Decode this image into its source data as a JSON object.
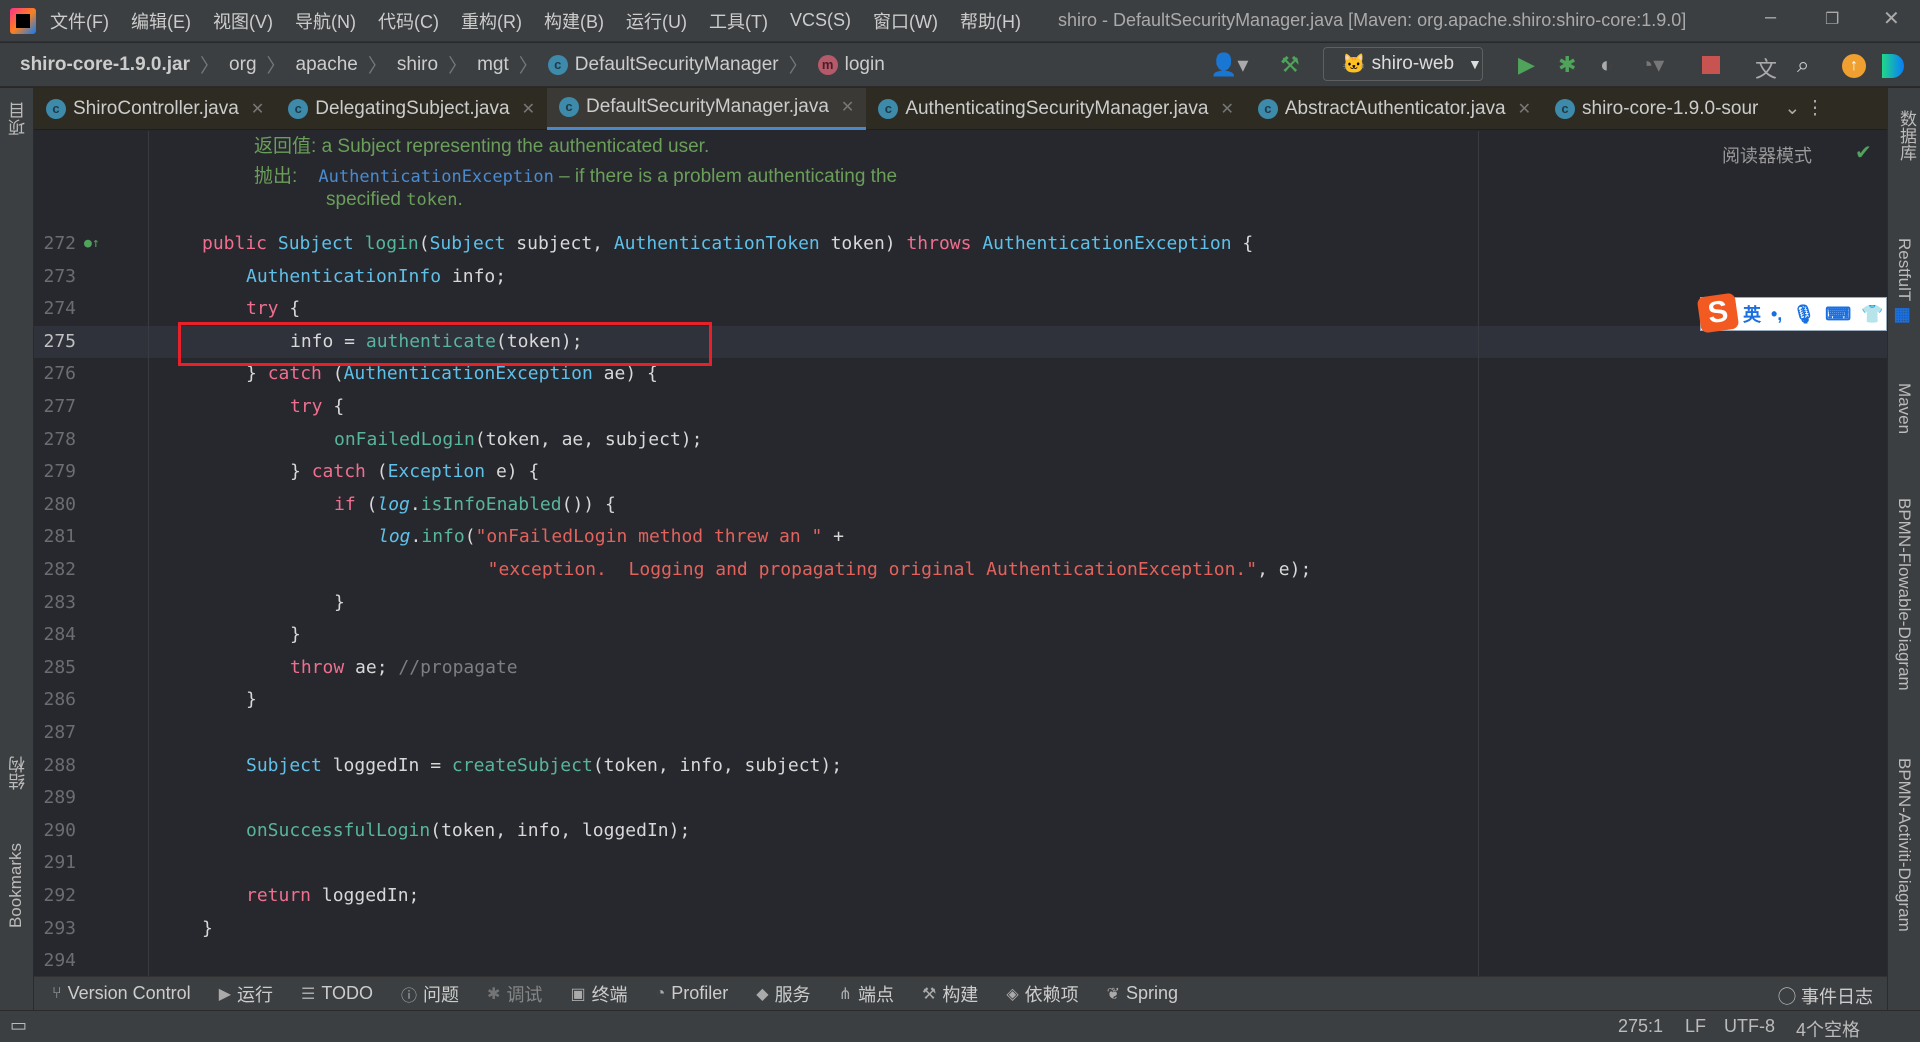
{
  "menubar": {
    "items": [
      "文件(F)",
      "编辑(E)",
      "视图(V)",
      "导航(N)",
      "代码(C)",
      "重构(R)",
      "构建(B)",
      "运行(U)",
      "工具(T)",
      "VCS(S)",
      "窗口(W)",
      "帮助(H)"
    ]
  },
  "window_title": "shiro - DefaultSecurityManager.java [Maven: org.apache.shiro:shiro-core:1.9.0]",
  "breadcrumb": {
    "root": "shiro-core-1.9.0.jar",
    "parts": [
      "org",
      "apache",
      "shiro",
      "mgt"
    ],
    "class": "DefaultSecurityManager",
    "method": "login"
  },
  "run_config": "shiro-web",
  "tabs": [
    {
      "label": "ShiroController.java",
      "icon": "c"
    },
    {
      "label": "DelegatingSubject.java",
      "icon": "c"
    },
    {
      "label": "DefaultSecurityManager.java",
      "icon": "c",
      "active": true
    },
    {
      "label": "AuthenticatingSecurityManager.java",
      "icon": "c"
    },
    {
      "label": "AbstractAuthenticator.java",
      "icon": "c"
    },
    {
      "label": "shiro-core-1.9.0-sour",
      "icon": "c"
    }
  ],
  "left_tools": [
    "项目",
    "结构",
    "Bookmarks"
  ],
  "right_tools": [
    "数据库",
    "RestfulT",
    "Maven",
    "BPMN-Flowable-Diagram",
    "BPMN-Activiti-Diagram"
  ],
  "reader_mode": "阅读器模式",
  "doc": {
    "returns_label": "返回值:",
    "returns_text": "a Subject representing the authenticated user.",
    "throws_label": "抛出:",
    "throws_link": "AuthenticationException",
    "throws_text": " – if there is a problem authenticating the",
    "throws_text2": "specified ",
    "throws_code": "token",
    "throws_end": "."
  },
  "code": [
    {
      "n": "272",
      "i": 0,
      "t": [
        [
          "kw",
          "public "
        ],
        [
          "ty",
          "Subject "
        ],
        [
          "fn",
          "login"
        ],
        [
          "pl",
          "("
        ],
        [
          "ty",
          "Subject "
        ],
        [
          "pl",
          "subject, "
        ],
        [
          "ty",
          "AuthenticationToken "
        ],
        [
          "pl",
          "token) "
        ],
        [
          "kw",
          "throws "
        ],
        [
          "ty",
          "AuthenticationException "
        ],
        [
          "pl",
          "{"
        ]
      ]
    },
    {
      "n": "273",
      "i": 1,
      "t": [
        [
          "ty",
          "AuthenticationInfo "
        ],
        [
          "pl",
          "info;"
        ]
      ]
    },
    {
      "n": "274",
      "i": 1,
      "t": [
        [
          "kw",
          "try "
        ],
        [
          "pl",
          "{"
        ]
      ]
    },
    {
      "n": "275",
      "i": 2,
      "t": [
        [
          "pl",
          "info = "
        ],
        [
          "fn",
          "authenticate"
        ],
        [
          "pl",
          "(token);"
        ]
      ],
      "current": true
    },
    {
      "n": "276",
      "i": 1,
      "t": [
        [
          "pl",
          "} "
        ],
        [
          "kw",
          "catch "
        ],
        [
          "pl",
          "("
        ],
        [
          "ty",
          "AuthenticationException "
        ],
        [
          "pl",
          "ae) {"
        ]
      ]
    },
    {
      "n": "277",
      "i": 2,
      "t": [
        [
          "kw",
          "try "
        ],
        [
          "pl",
          "{"
        ]
      ]
    },
    {
      "n": "278",
      "i": 3,
      "t": [
        [
          "fn",
          "onFailedLogin"
        ],
        [
          "pl",
          "(token, ae, subject);"
        ]
      ]
    },
    {
      "n": "279",
      "i": 2,
      "t": [
        [
          "pl",
          "} "
        ],
        [
          "kw",
          "catch "
        ],
        [
          "pl",
          "("
        ],
        [
          "ty",
          "Exception "
        ],
        [
          "pl",
          "e) {"
        ]
      ]
    },
    {
      "n": "280",
      "i": 3,
      "t": [
        [
          "kw",
          "if "
        ],
        [
          "pl",
          "("
        ],
        [
          "it",
          "log"
        ],
        [
          "pl",
          "."
        ],
        [
          "fn",
          "isInfoEnabled"
        ],
        [
          "pl",
          "()) {"
        ]
      ]
    },
    {
      "n": "281",
      "i": 4,
      "t": [
        [
          "it",
          "log"
        ],
        [
          "pl",
          "."
        ],
        [
          "fn",
          "info"
        ],
        [
          "pl",
          "("
        ],
        [
          "st",
          "\"onFailedLogin method threw an \""
        ],
        [
          "pl",
          " +"
        ]
      ]
    },
    {
      "n": "282",
      "i": 6,
      "t": [
        [
          "st",
          "  \"exception.  Logging and propagating original AuthenticationException.\""
        ],
        [
          "pl",
          ", e);"
        ]
      ]
    },
    {
      "n": "283",
      "i": 3,
      "t": [
        [
          "pl",
          "}"
        ]
      ]
    },
    {
      "n": "284",
      "i": 2,
      "t": [
        [
          "pl",
          "}"
        ]
      ]
    },
    {
      "n": "285",
      "i": 2,
      "t": [
        [
          "kw",
          "throw "
        ],
        [
          "pl",
          "ae; "
        ],
        [
          "cm",
          "//propagate"
        ]
      ]
    },
    {
      "n": "286",
      "i": 1,
      "t": [
        [
          "pl",
          "}"
        ]
      ]
    },
    {
      "n": "287",
      "i": 0,
      "t": []
    },
    {
      "n": "288",
      "i": 1,
      "t": [
        [
          "ty",
          "Subject "
        ],
        [
          "pl",
          "loggedIn = "
        ],
        [
          "fn",
          "createSubject"
        ],
        [
          "pl",
          "(token, info, subject);"
        ]
      ]
    },
    {
      "n": "289",
      "i": 0,
      "t": []
    },
    {
      "n": "290",
      "i": 1,
      "t": [
        [
          "fn",
          "onSuccessfulLogin"
        ],
        [
          "pl",
          "(token, info, loggedIn);"
        ]
      ]
    },
    {
      "n": "291",
      "i": 0,
      "t": []
    },
    {
      "n": "292",
      "i": 1,
      "t": [
        [
          "kw",
          "return "
        ],
        [
          "pl",
          "loggedIn;"
        ]
      ]
    },
    {
      "n": "293",
      "i": 0,
      "t": [
        [
          "pl",
          "}"
        ]
      ]
    },
    {
      "n": "294",
      "i": 0,
      "t": []
    }
  ],
  "ime": {
    "mode": "英"
  },
  "toolwindows": [
    {
      "label": "Version Control",
      "icon": "branch-icon"
    },
    {
      "label": "运行",
      "icon": "run-icon"
    },
    {
      "label": "TODO",
      "icon": "list-icon"
    },
    {
      "label": "问题",
      "icon": "problems-icon"
    },
    {
      "label": "调试",
      "icon": "debug-icon"
    },
    {
      "label": "终端",
      "icon": "terminal-icon"
    },
    {
      "label": "Profiler",
      "icon": "profiler-icon"
    },
    {
      "label": "服务",
      "icon": "services-icon"
    },
    {
      "label": "端点",
      "icon": "endpoints-icon"
    },
    {
      "label": "构建",
      "icon": "build-icon"
    },
    {
      "label": "依赖项",
      "icon": "dependencies-icon"
    },
    {
      "label": "Spring",
      "icon": "spring-icon"
    }
  ],
  "event_log": "事件日志",
  "status": {
    "position": "275:1",
    "line_sep": "LF",
    "encoding": "UTF-8",
    "indent": "4个空格"
  },
  "colors": {
    "accent": "#4a88c7",
    "highlight_box": "#e8202a"
  }
}
